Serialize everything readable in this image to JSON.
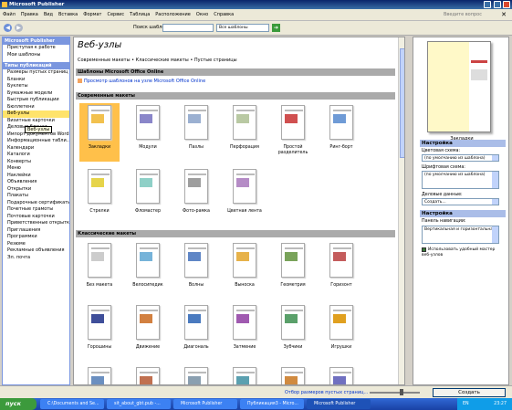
{
  "window": {
    "title": "Microsoft Publisher"
  },
  "menu": {
    "items": [
      "Файл",
      "Правка",
      "Вид",
      "Вставка",
      "Формат",
      "Сервис",
      "Таблица",
      "Расположение",
      "Окно",
      "Справка"
    ],
    "help_placeholder": "Введите вопрос",
    "close": "✕"
  },
  "toolbar": {
    "back": "◀",
    "forward": "▶",
    "search_label": "Поиск шаблонов:",
    "search_value": "",
    "scope_value": "Все шаблоны",
    "go": "➔"
  },
  "left": {
    "section1_title": "Microsoft Publisher",
    "section1_items": [
      "Приступая к работе",
      "Мои шаблоны"
    ],
    "section2_title": "Типы публикаций",
    "types": [
      "Размеры пустых страниц",
      "Бланки",
      "Буклеты",
      "Бумажные модели",
      "Быстрые публикации",
      "Бюллетени",
      "Веб-узлы",
      "Визитные карточки",
      "Деловые бланки",
      "Импорт документов Word",
      "Информационные табли...",
      "Календари",
      "Каталоги",
      "Конверты",
      "Меню",
      "Наклейки",
      "Объявления",
      "Открытки",
      "Плакаты",
      "Подарочные сертификаты",
      "Почетные грамоты",
      "Почтовые карточки",
      "Приветственные открытки",
      "Приглашения",
      "Программки",
      "Резюме",
      "Рекламные объявления",
      "Эл. почта"
    ],
    "selected_index": 6,
    "tooltip": "Веб-узлы"
  },
  "main": {
    "title": "Веб-узлы",
    "breadcrumb": "Современные макеты • Классические макеты • Пустые страницы",
    "band_online": "Шаблоны Microsoft Office Online",
    "online_link": "Просмотр шаблонов на узле Microsoft Office Online",
    "band_modern": "Современные макеты",
    "modern": [
      {
        "name": "Закладки",
        "accent": "#f2c14e"
      },
      {
        "name": "Модули",
        "accent": "#8a86c9"
      },
      {
        "name": "Пазлы",
        "accent": "#9bb0d1"
      },
      {
        "name": "Перфорация",
        "accent": "#b9c9a3"
      },
      {
        "name": "Простой разделитель",
        "accent": "#d05050"
      },
      {
        "name": "Ринг-борт",
        "accent": "#6f9bd6"
      },
      {
        "name": "Стрелки",
        "accent": "#e6d44a"
      },
      {
        "name": "Фломастер",
        "accent": "#8fd0c7"
      },
      {
        "name": "Фото-рамка",
        "accent": "#9e9e9e"
      },
      {
        "name": "Цветная лента",
        "accent": "#b58cc6"
      }
    ],
    "band_classic": "Классические макеты",
    "classic": [
      {
        "name": "Без макета",
        "accent": "#cccccc"
      },
      {
        "name": "Велосипедик",
        "accent": "#76b3d9"
      },
      {
        "name": "Волны",
        "accent": "#5f86c6"
      },
      {
        "name": "Выноска",
        "accent": "#e7b24a"
      },
      {
        "name": "Геометрия",
        "accent": "#79a35a"
      },
      {
        "name": "Горизонт",
        "accent": "#c45c5c"
      },
      {
        "name": "Горошины",
        "accent": "#3f4f9a"
      },
      {
        "name": "Движение",
        "accent": "#d28040"
      },
      {
        "name": "Диагональ",
        "accent": "#4a7abf"
      },
      {
        "name": "Затмение",
        "accent": "#a05ab0"
      },
      {
        "name": "Зубчики",
        "accent": "#5aa06a"
      },
      {
        "name": "Игрушки",
        "accent": "#e0a020"
      },
      {
        "name": "",
        "accent": "#6b8fc0"
      },
      {
        "name": "",
        "accent": "#c07050"
      },
      {
        "name": "",
        "accent": "#8a9fb0"
      },
      {
        "name": "",
        "accent": "#5ba0b0"
      },
      {
        "name": "",
        "accent": "#d08a40"
      },
      {
        "name": "",
        "accent": "#7070c0"
      }
    ]
  },
  "right": {
    "preview_name": "Закладки",
    "settings_title": "Настройка",
    "color_label": "Цветовая схема:",
    "color_value": "(по умолчанию из шаблона)",
    "font_label": "Шрифтовая схема:",
    "font_value": "(по умолчанию из шаблона)",
    "biz_label": "Деловые данные:",
    "biz_value": "Создать...",
    "options_title": "Настройка",
    "nav_label": "Панель навигации:",
    "nav_value": "Вертикальная и горизонтальная",
    "wizard_check": "Использовать удобный мастер веб-узлов"
  },
  "bottom": {
    "link": "Отбор размеров пустых страниц...",
    "create": "Создать"
  },
  "taskbar": {
    "start": "пуск",
    "tasks": [
      "C:\\Documents and Se...",
      "sit_about_gbt.pub -...",
      "Microsoft Publisher",
      "Публикация3 - Micro...",
      "Microsoft Publisher"
    ],
    "active_index": 4,
    "lang": "EN",
    "clock": "23:27"
  }
}
